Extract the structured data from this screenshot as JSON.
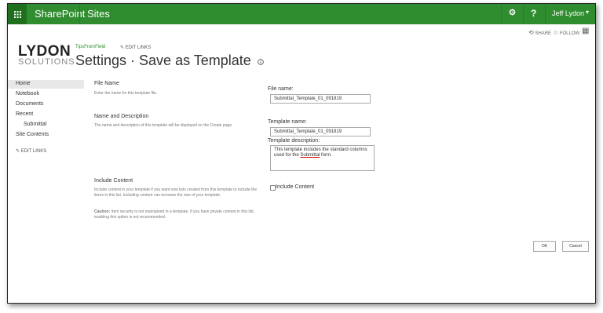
{
  "suite_bar": {
    "brand": "SharePoint",
    "sites": "Sites",
    "user": "Jeff Lydon",
    "waffle_icon": "app-launcher-icon",
    "gear_icon": "gear-icon",
    "help_icon": "help-icon",
    "help_text": "?"
  },
  "actions": {
    "share": "SHARE",
    "follow": "FOLLOW"
  },
  "logo": {
    "top": "LYDON",
    "bottom": "SOLUTIONS"
  },
  "header": {
    "breadcrumb": "TipsFromField",
    "edit_links": "EDIT LINKS",
    "title": "Settings · Save as Template",
    "info_icon": "info-icon"
  },
  "left_nav": {
    "items": [
      {
        "label": "Home"
      },
      {
        "label": "Notebook"
      },
      {
        "label": "Documents"
      },
      {
        "label": "Recent"
      },
      {
        "label": "Submittal"
      },
      {
        "label": "Site Contents"
      }
    ],
    "edit_links": "EDIT LINKS"
  },
  "sections": {
    "file_name": {
      "title": "File Name",
      "desc": "Enter the name for this template file."
    },
    "name_desc": {
      "title": "Name and Description",
      "desc": "The name and description of this template will be displayed on the Create page."
    },
    "include_content": {
      "title": "Include Content",
      "desc": "Include content in your template if you want new lists created from this template to include the items in this list. Including content can increase the size of your template.",
      "caution_label": "Caution:",
      "caution": "Item security is not maintained in a template. If you have private content in this list, enabling this option is not recommended."
    }
  },
  "form": {
    "file_name_label": "File name:",
    "file_name_value": "Submittal_Template_01_091819",
    "template_name_label": "Template name:",
    "template_name_value": "Submittal_Template_01_091819",
    "template_desc_label": "Template description:",
    "template_desc_prefix": "This template includes the standard columns used for the ",
    "template_desc_link": "Submittal",
    "template_desc_suffix": " form.",
    "include_content_label": "Include Content",
    "include_content_checked": false
  },
  "buttons": {
    "ok": "OK",
    "cancel": "Cancel"
  }
}
